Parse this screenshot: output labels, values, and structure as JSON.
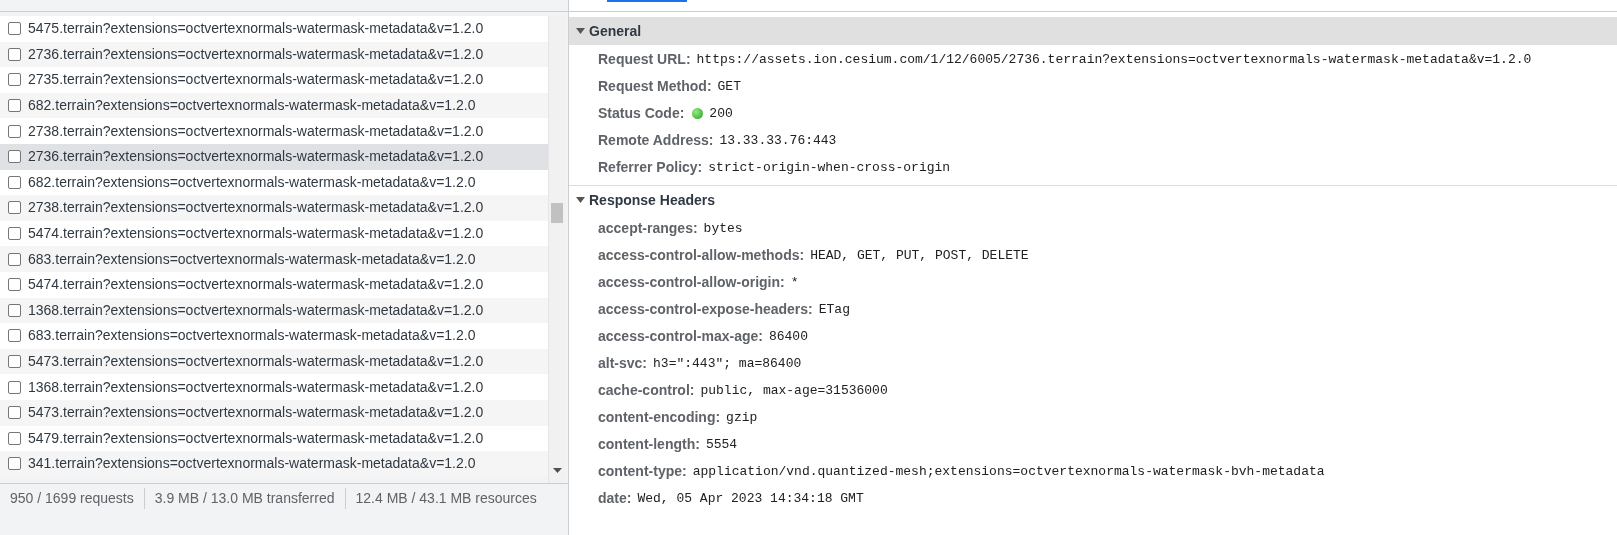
{
  "requests": [
    {
      "name": "5475.terrain?extensions=octvertexnormals-watermask-metadata&v=1.2.0",
      "selected": false
    },
    {
      "name": "2736.terrain?extensions=octvertexnormals-watermask-metadata&v=1.2.0",
      "selected": false
    },
    {
      "name": "2735.terrain?extensions=octvertexnormals-watermask-metadata&v=1.2.0",
      "selected": false
    },
    {
      "name": "682.terrain?extensions=octvertexnormals-watermask-metadata&v=1.2.0",
      "selected": false
    },
    {
      "name": "2738.terrain?extensions=octvertexnormals-watermask-metadata&v=1.2.0",
      "selected": false
    },
    {
      "name": "2736.terrain?extensions=octvertexnormals-watermask-metadata&v=1.2.0",
      "selected": true
    },
    {
      "name": "682.terrain?extensions=octvertexnormals-watermask-metadata&v=1.2.0",
      "selected": false
    },
    {
      "name": "2738.terrain?extensions=octvertexnormals-watermask-metadata&v=1.2.0",
      "selected": false
    },
    {
      "name": "5474.terrain?extensions=octvertexnormals-watermask-metadata&v=1.2.0",
      "selected": false
    },
    {
      "name": "683.terrain?extensions=octvertexnormals-watermask-metadata&v=1.2.0",
      "selected": false
    },
    {
      "name": "5474.terrain?extensions=octvertexnormals-watermask-metadata&v=1.2.0",
      "selected": false
    },
    {
      "name": "1368.terrain?extensions=octvertexnormals-watermask-metadata&v=1.2.0",
      "selected": false
    },
    {
      "name": "683.terrain?extensions=octvertexnormals-watermask-metadata&v=1.2.0",
      "selected": false
    },
    {
      "name": "5473.terrain?extensions=octvertexnormals-watermask-metadata&v=1.2.0",
      "selected": false
    },
    {
      "name": "1368.terrain?extensions=octvertexnormals-watermask-metadata&v=1.2.0",
      "selected": false
    },
    {
      "name": "5473.terrain?extensions=octvertexnormals-watermask-metadata&v=1.2.0",
      "selected": false
    },
    {
      "name": "5479.terrain?extensions=octvertexnormals-watermask-metadata&v=1.2.0",
      "selected": false
    },
    {
      "name": "341.terrain?extensions=octvertexnormals-watermask-metadata&v=1.2.0",
      "selected": false
    }
  ],
  "status_bar": [
    "950 / 1699 requests",
    "3.9 MB / 13.0 MB transferred",
    "12.4 MB / 43.1 MB resources"
  ],
  "sections": [
    {
      "title": "General",
      "expanded": true,
      "rows": [
        {
          "key": "Request URL:",
          "value": "https://assets.ion.cesium.com/1/12/6005/2736.terrain?extensions=octvertexnormals-watermask-metadata&v=1.2.0"
        },
        {
          "key": "Request Method:",
          "value": "GET"
        },
        {
          "key": "Status Code:",
          "value": "200",
          "kind": "status"
        },
        {
          "key": "Remote Address:",
          "value": "13.33.33.76:443"
        },
        {
          "key": "Referrer Policy:",
          "value": "strict-origin-when-cross-origin"
        }
      ]
    },
    {
      "title": "Response Headers",
      "expanded": true,
      "rows": [
        {
          "key": "accept-ranges:",
          "value": "bytes"
        },
        {
          "key": "access-control-allow-methods:",
          "value": "HEAD, GET, PUT, POST, DELETE"
        },
        {
          "key": "access-control-allow-origin:",
          "value": "*"
        },
        {
          "key": "access-control-expose-headers:",
          "value": "ETag"
        },
        {
          "key": "access-control-max-age:",
          "value": "86400"
        },
        {
          "key": "alt-svc:",
          "value": "h3=\":443\"; ma=86400"
        },
        {
          "key": "cache-control:",
          "value": "public, max-age=31536000"
        },
        {
          "key": "content-encoding:",
          "value": "gzip"
        },
        {
          "key": "content-length:",
          "value": "5554"
        },
        {
          "key": "content-type:",
          "value": "application/vnd.quantized-mesh;extensions=octvertexnormals-watermask-bvh-metadata"
        },
        {
          "key": "date:",
          "value": "Wed, 05 Apr 2023 14:34:18 GMT"
        }
      ]
    }
  ]
}
